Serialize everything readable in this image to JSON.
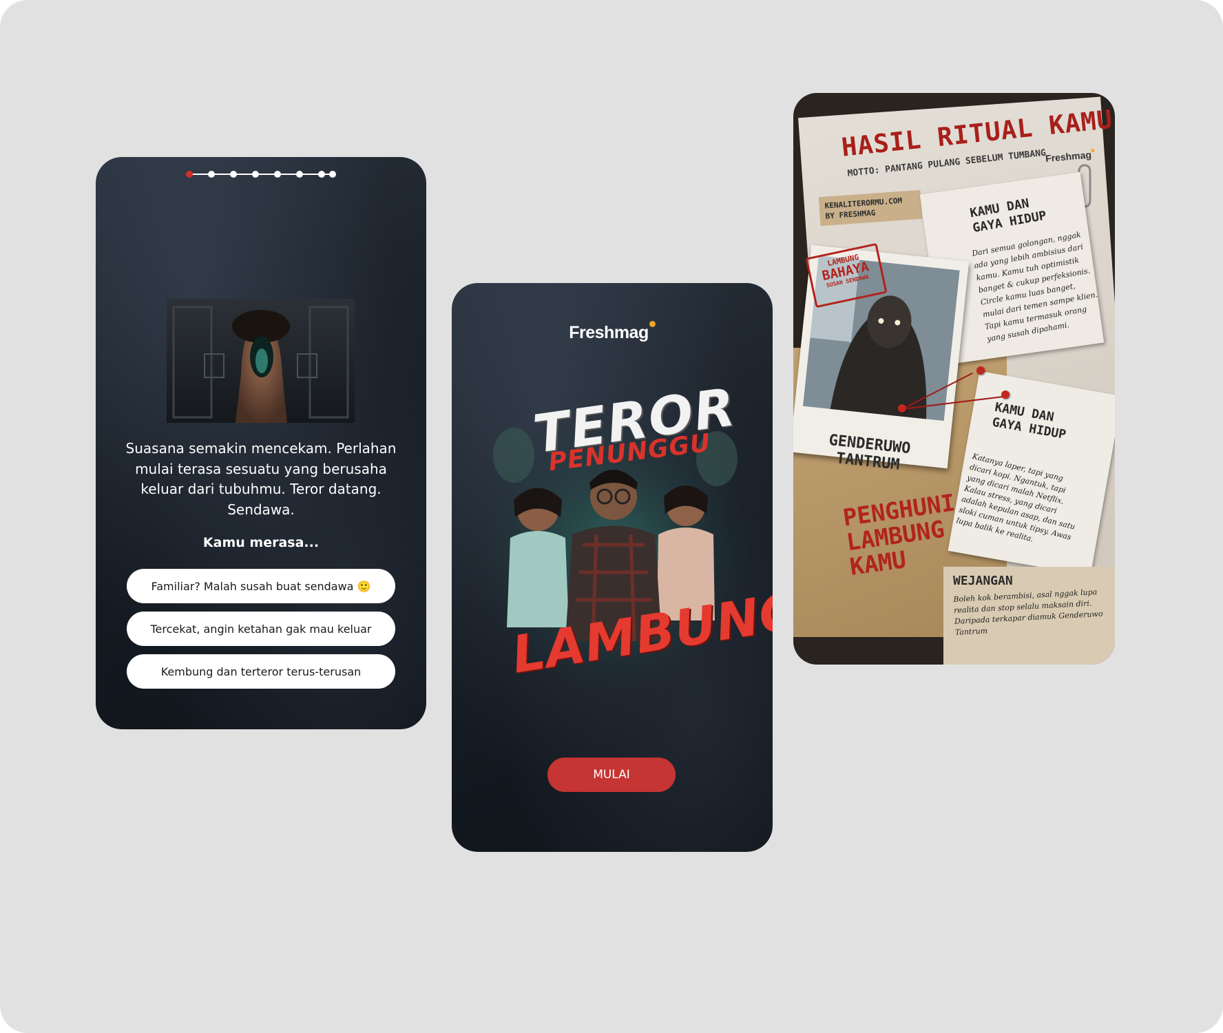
{
  "colors": {
    "page_background": "#e1e1e1",
    "screen_dark": "#171d25",
    "accent_red": "#c53533",
    "logo_accent": "#f1a52b"
  },
  "quiz_screen": {
    "progress": {
      "current_step": 1,
      "total_steps": 8
    },
    "photo_icon": "screaming-woman-photo",
    "narration": "Suasana semakin mencekam. Perlahan mulai terasa sesuatu yang berusaha keluar dari tubuhmu. Teror datang. Sendawa.",
    "question": "Kamu merasa...",
    "options": [
      {
        "label": "Familiar? Malah susah buat sendawa 🙂"
      },
      {
        "label": "Tercekat, angin ketahan gak mau keluar"
      },
      {
        "label": "Kembung dan terteror terus-terusan"
      }
    ]
  },
  "title_screen": {
    "logo": "Freshmag",
    "title_line1": "TEROR",
    "title_line2": "PENUNGGU",
    "title_line3": "LAMBUNG",
    "start_button": "MULAI"
  },
  "result_screen": {
    "heading": "HASIL RITUAL KAMU",
    "motto": "MOTTO: PANTANG PULANG SEBELUM TUMBANG",
    "logo": "Freshmag",
    "tag_line1": "KENALITERORMU.COM",
    "tag_line2": "BY FRESHMAG",
    "stamp_line1": "LAMBUNG",
    "stamp_line2": "BAHAYA",
    "stamp_line3": "SUSAH SENDAWA",
    "polaroid_caption_line1": "GENDERUWO",
    "polaroid_caption_line2": "TANTRUM",
    "penghuni_line1": "PENGHUNI",
    "penghuni_line2": "LAMBUNG",
    "penghuni_line3": "KAMU",
    "note1_title_line1": "KAMU DAN",
    "note1_title_line2": "GAYA HIDUP",
    "note1_body": "Dari semua golongan, nggak ada yang lebih ambisius dari kamu. Kamu tuh optimistik banget & cukup perfeksionis. Circle kamu luas banget, mulai dari temen sampe klien. Tapi kamu termasuk orang yang susah dipahami.",
    "note2_title_line1": "KAMU DAN",
    "note2_title_line2": "GAYA HIDUP",
    "note2_body": "Katanya laper, tapi yang dicari kopi. Ngantuk, tapi yang dicari malah Netflix. Kalau stress, yang dicari adalah kepulan asap, dan satu sloki cuman untuk tipsy. Awas lupa balik ke realita.",
    "note3_title": "WEJANGAN",
    "note3_body": "Boleh kok berambisi, asal nggak lupa realita dan stop selalu maksain diri. Daripada terkapar diamuk Genderuwo Tantrum"
  }
}
